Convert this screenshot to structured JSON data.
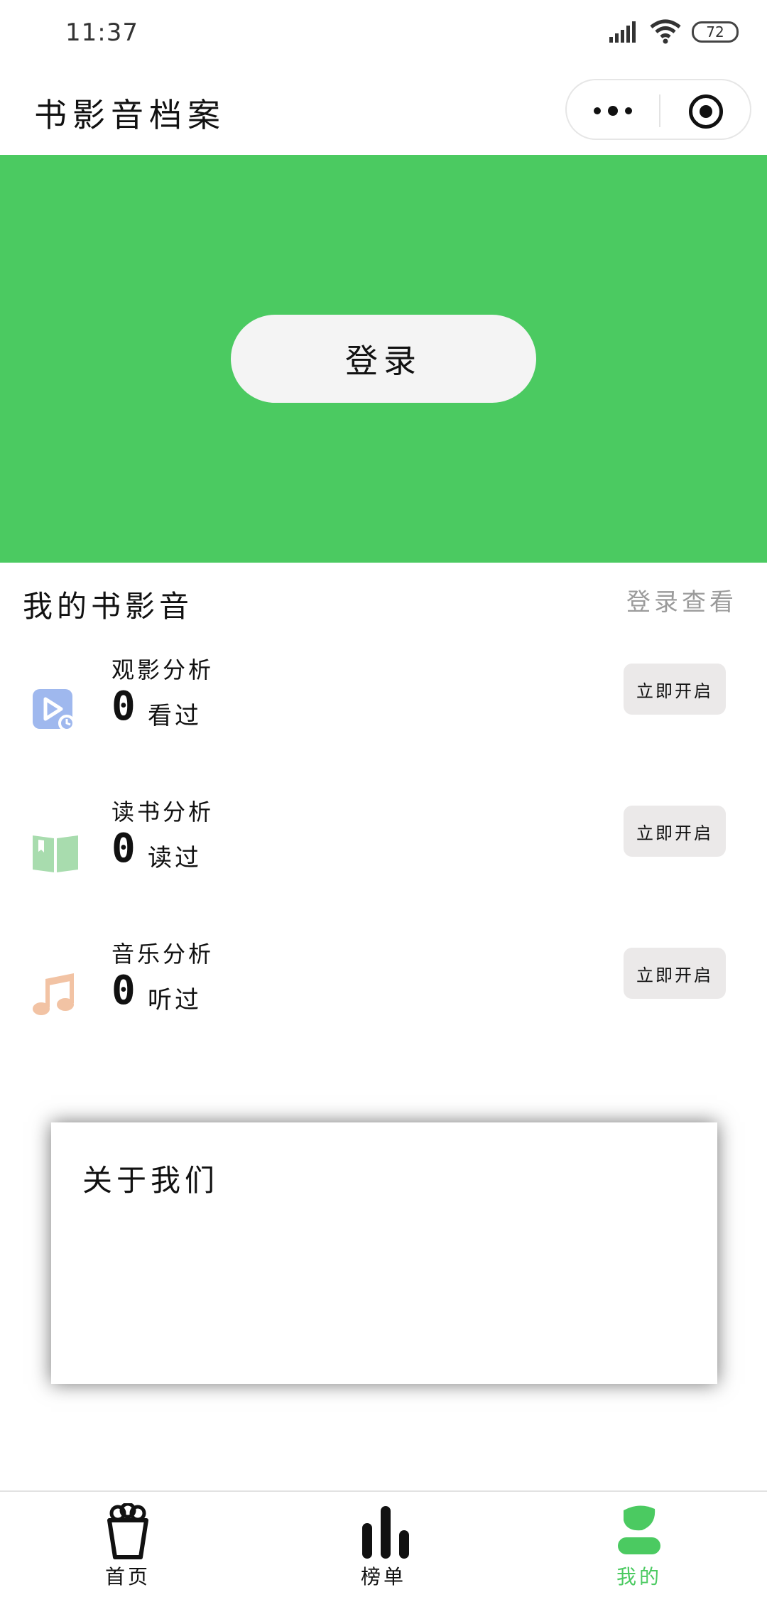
{
  "status_bar": {
    "time": "11:37",
    "battery": "72"
  },
  "header": {
    "title": "书影音档案"
  },
  "banner": {
    "login_label": "登录",
    "color": "#4bca61"
  },
  "section": {
    "title": "我的书影音",
    "link": "登录查看"
  },
  "analysis": [
    {
      "icon": "video-play-icon",
      "label": "观影分析",
      "count": "0",
      "unit": "看过",
      "action": "立即开启",
      "color": "#9fb8ee"
    },
    {
      "icon": "book-icon",
      "label": "读书分析",
      "count": "0",
      "unit": "读过",
      "action": "立即开启",
      "color": "#a8dcae"
    },
    {
      "icon": "music-note-icon",
      "label": "音乐分析",
      "count": "0",
      "unit": "听过",
      "action": "立即开启",
      "color": "#f2c3a4"
    }
  ],
  "about": {
    "title": "关于我们"
  },
  "tabbar": {
    "tabs": [
      {
        "icon": "popcorn-icon",
        "label": "首页",
        "active": false
      },
      {
        "icon": "bar-chart-icon",
        "label": "榜单",
        "active": false
      },
      {
        "icon": "user-icon",
        "label": "我的",
        "active": true
      }
    ],
    "active_color": "#4bca61"
  }
}
